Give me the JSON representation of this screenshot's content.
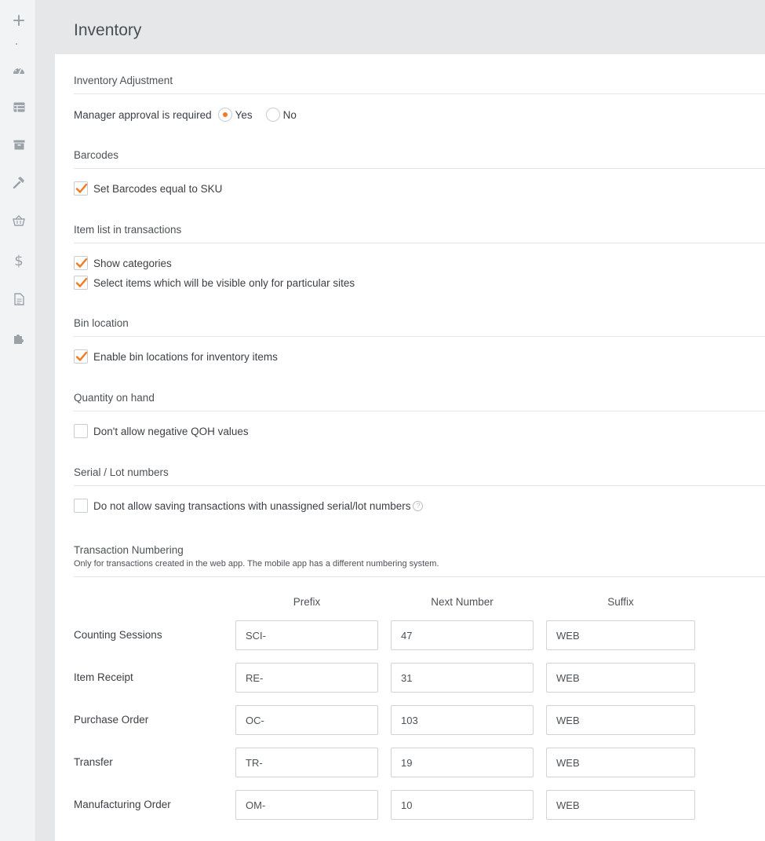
{
  "page": {
    "title": "Inventory"
  },
  "sidebar": {
    "icons": [
      "plus-icon",
      "dashboard-icon",
      "table-icon",
      "archive-icon",
      "hammer-icon",
      "basket-icon",
      "dollar-icon",
      "document-icon",
      "puzzle-icon"
    ]
  },
  "inventory_adjustment": {
    "title": "Inventory Adjustment",
    "label": "Manager approval is required",
    "options": [
      {
        "label": "Yes",
        "selected": true
      },
      {
        "label": "No",
        "selected": false
      }
    ]
  },
  "barcodes": {
    "title": "Barcodes",
    "items": [
      {
        "label": "Set Barcodes equal to SKU",
        "checked": true
      }
    ]
  },
  "item_list": {
    "title": "Item list in transactions",
    "items": [
      {
        "label": "Show categories",
        "checked": true
      },
      {
        "label": "Select items which will be visible only for particular sites",
        "checked": true
      }
    ]
  },
  "bin_location": {
    "title": "Bin location",
    "items": [
      {
        "label": "Enable bin locations for inventory items",
        "checked": true
      }
    ]
  },
  "qoh": {
    "title": "Quantity on hand",
    "items": [
      {
        "label": "Don't allow negative QOH values",
        "checked": false
      }
    ]
  },
  "serial": {
    "title": "Serial / Lot numbers",
    "items": [
      {
        "label": "Do not allow saving transactions with unassigned serial/lot numbers",
        "checked": false
      }
    ],
    "help": "?"
  },
  "numbering": {
    "title": "Transaction Numbering",
    "subtitle": "Only for transactions created in the web app. The mobile app has a different numbering system.",
    "columns": [
      "Prefix",
      "Next Number",
      "Suffix"
    ],
    "rows": [
      {
        "label": "Counting Sessions",
        "prefix": "SCI-",
        "next": "47",
        "suffix": "WEB"
      },
      {
        "label": "Item Receipt",
        "prefix": "RE-",
        "next": "31",
        "suffix": "WEB"
      },
      {
        "label": "Purchase Order",
        "prefix": "OC-",
        "next": "103",
        "suffix": "WEB"
      },
      {
        "label": "Transfer",
        "prefix": "TR-",
        "next": "19",
        "suffix": "WEB"
      },
      {
        "label": "Manufacturing Order",
        "prefix": "OM-",
        "next": "10",
        "suffix": "WEB"
      }
    ]
  },
  "colors": {
    "accent": "#f47a20"
  }
}
